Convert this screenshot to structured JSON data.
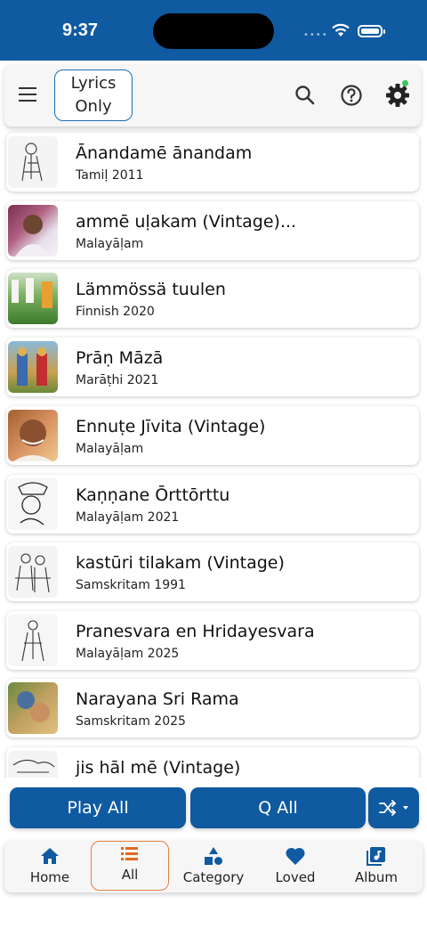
{
  "status": {
    "time": "9:37"
  },
  "header": {
    "lyrics_line1": "Lyrics",
    "lyrics_line2": "Only"
  },
  "songs": [
    {
      "title": "Ānandamē ānandam",
      "subtitle": "Tamiḷ 2011"
    },
    {
      "title": "ammē uḷakam (Vintage)...",
      "subtitle": "Malayāḷam"
    },
    {
      "title": "Lämmössä tuulen",
      "subtitle": "Finnish 2020"
    },
    {
      "title": "Prāṇ Māzā",
      "subtitle": "Marāṭhi 2021"
    },
    {
      "title": "Ennuṭe Jīvita (Vintage)",
      "subtitle": "Malayāḷam"
    },
    {
      "title": "Kaṇṇane Ōrttōrttu",
      "subtitle": "Malayāḷam 2021"
    },
    {
      "title": "kastūri tilakam (Vintage)",
      "subtitle": "Samskritam 1991"
    },
    {
      "title": "Pranesvara en Hridayesvara",
      "subtitle": "Malayāḷam 2025"
    },
    {
      "title": "Narayana Sri Rama",
      "subtitle": "Samskritam 2025"
    },
    {
      "title": "jis hāl mē (Vintage)",
      "subtitle": ""
    }
  ],
  "actions": {
    "play_all": "Play All",
    "q_all": "Q All"
  },
  "tabs": [
    {
      "label": "Home",
      "icon": "home-icon"
    },
    {
      "label": "All",
      "icon": "list-icon"
    },
    {
      "label": "Category",
      "icon": "shapes-icon"
    },
    {
      "label": "Loved",
      "icon": "heart-icon"
    },
    {
      "label": "Album",
      "icon": "album-icon"
    }
  ],
  "colors": {
    "primary": "#0f5aa0",
    "active_tab_border": "#e08040",
    "notification_dot": "#3cc45a"
  }
}
